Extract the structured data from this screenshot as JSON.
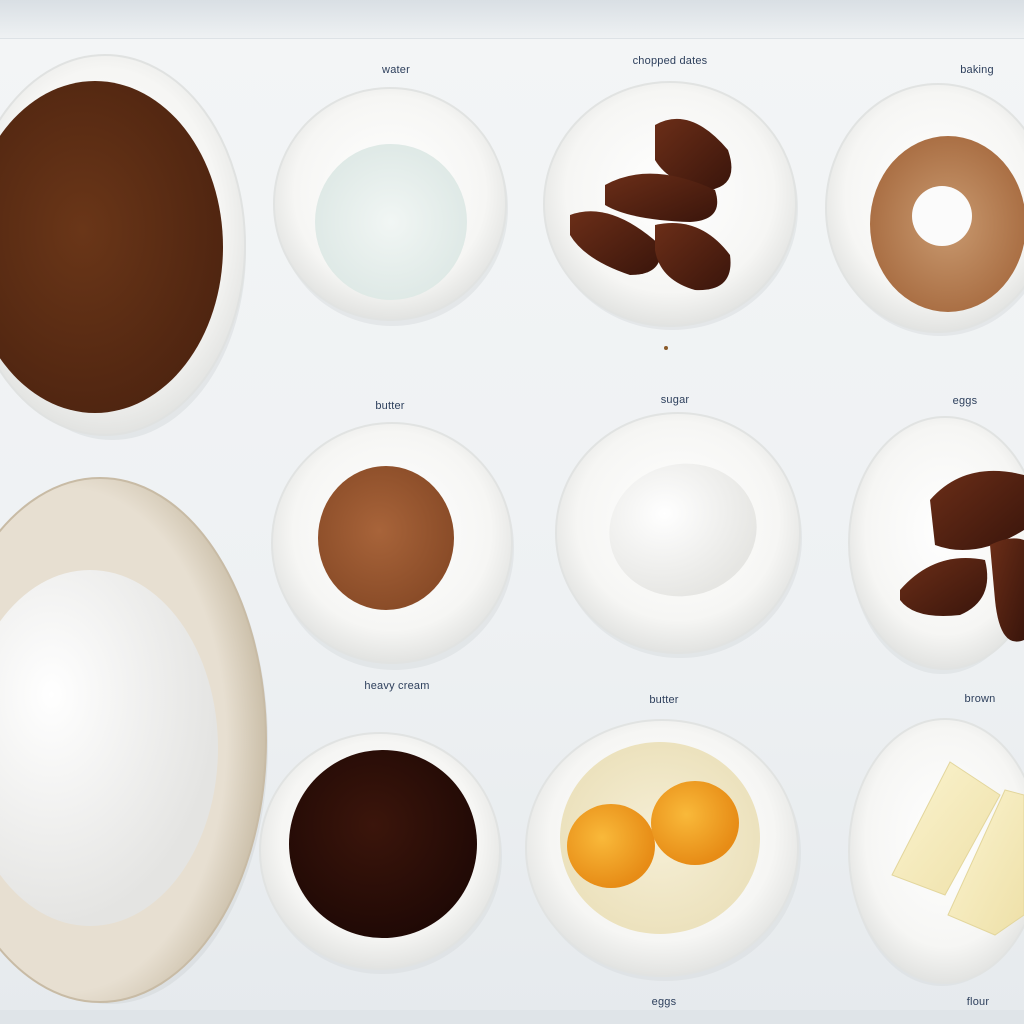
{
  "labels": {
    "water": "water",
    "chopped_dates": "chopped dates",
    "baking": "baking",
    "butter_top": "butter",
    "sugar": "sugar",
    "eggs_top": "eggs",
    "heavy_cream": "heavy cream",
    "butter_bottom": "butter",
    "brown": "brown",
    "eggs_bottom": "eggs",
    "flour": "flour"
  },
  "colors": {
    "surface": "#eef1f3",
    "bowl_white": "#fbfbfa",
    "caramel_sauce": "#5a2c13",
    "water": "#e7f0ee",
    "brown_sugar": "#b57a4f",
    "cinnamon": "#9b5a31",
    "egg_shell": "#f6f6f4",
    "dates": "#4b1f12",
    "flour": "#f4f4f2",
    "large_bowl_rim": "#d8cdbb",
    "dark_syrup": "#2a0e08",
    "yolk": "#f2a124",
    "butter": "#f5edc0",
    "label_text": "#2d3f5c"
  }
}
